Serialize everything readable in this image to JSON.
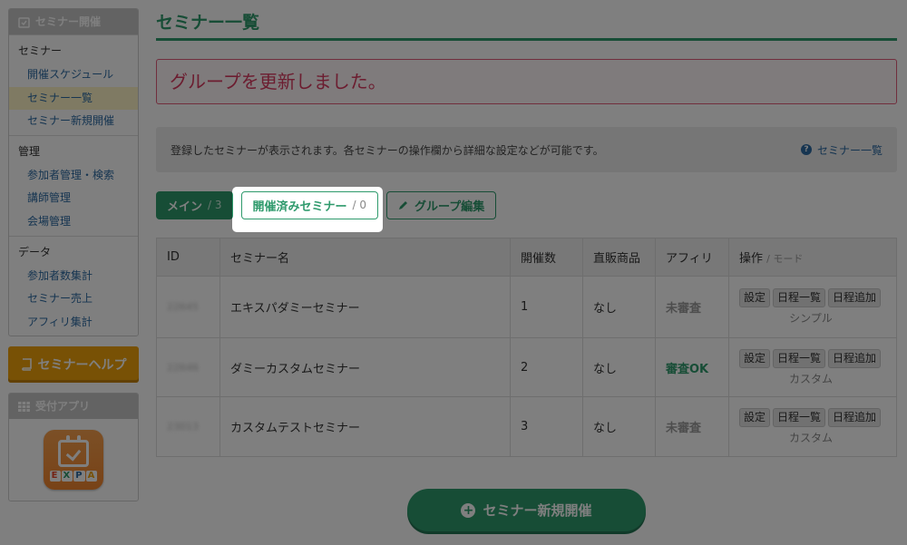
{
  "sidebar": {
    "seminar_panel_title": "セミナー開催",
    "groups": [
      {
        "title": "セミナー",
        "items": [
          "開催スケジュール",
          "セミナー一覧",
          "セミナー新規開催"
        ]
      },
      {
        "title": "管理",
        "items": [
          "参加者管理・検索",
          "講師管理",
          "会場管理"
        ]
      },
      {
        "title": "データ",
        "items": [
          "参加者数集計",
          "セミナー売上",
          "アフィリ集計"
        ]
      }
    ],
    "active_item": "セミナー一覧",
    "help_label": "セミナーヘルプ",
    "app_panel_title": "受付アプリ",
    "app_logo_text": "EXPA"
  },
  "main": {
    "title": "セミナー一覧",
    "alert": "グループを更新しました。",
    "info": "登録したセミナーが表示されます。各セミナーの操作欄から詳細な設定などが可能です。",
    "info_link": "セミナー一覧",
    "tabs": [
      {
        "label": "メイン",
        "count": "/ 3"
      },
      {
        "label": "開催済みセミナー",
        "count": "/ 0"
      },
      {
        "label": "グループ編集"
      }
    ],
    "table": {
      "headers": [
        "ID",
        "セミナー名",
        "開催数",
        "直販商品",
        "アフィリ",
        "操作",
        "/ モード"
      ],
      "rows": [
        {
          "id": "22645",
          "name": "エキスパダミーセミナー",
          "count": "1",
          "direct": "なし",
          "affili": "未審査",
          "affili_status": "wait",
          "mode": "シンプル"
        },
        {
          "id": "22646",
          "name": "ダミーカスタムセミナー",
          "count": "2",
          "direct": "なし",
          "affili": "審査OK",
          "affili_status": "ok",
          "mode": "カスタム"
        },
        {
          "id": "23013",
          "name": "カスタムテストセミナー",
          "count": "3",
          "direct": "なし",
          "affili": "未審査",
          "affili_status": "wait",
          "mode": "カスタム"
        }
      ],
      "op_buttons": [
        "設定",
        "日程一覧",
        "日程追加"
      ]
    },
    "new_button": "セミナー新規開催"
  },
  "colors": {
    "brand_green": "#2f9a6c",
    "alert_pink": "#e35d7a",
    "help_orange": "#f0a30a",
    "link_blue": "#2d6aa3"
  }
}
